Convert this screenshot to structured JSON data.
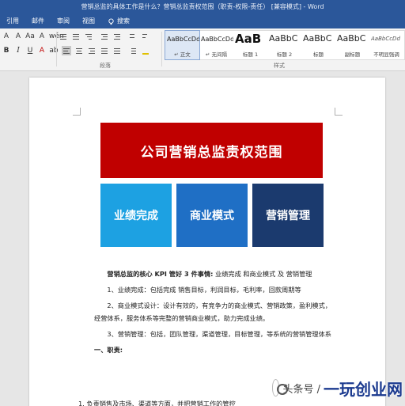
{
  "window": {
    "title": "营销总监的具体工作是什么？营销总监责权范围（职责-权限-责任） [兼容模式] - Word"
  },
  "ribbon_tabs": [
    "引用",
    "邮件",
    "审阅",
    "视图"
  ],
  "search": {
    "label": "搜索",
    "icon": "lightbulb-icon"
  },
  "font_controls": {
    "row1": [
      "A",
      "A",
      "Aa",
      "A",
      "wén",
      "A"
    ],
    "row2": [
      "B",
      "I",
      "U",
      "abc",
      "x₂",
      "x²"
    ],
    "row3": [
      "A",
      "ab",
      "A",
      "A",
      "A",
      "字"
    ]
  },
  "groups": {
    "paragraph_label": "段落",
    "styles_label": "样式"
  },
  "styles": [
    {
      "sample": "AaBbCcDd",
      "name": "↵ 正文",
      "selected": true
    },
    {
      "sample": "AaBbCcDd",
      "name": "↵ 无间隔",
      "selected": false
    },
    {
      "sample": "AaB",
      "name": "标题 1",
      "selected": false
    },
    {
      "sample": "AaBbC",
      "name": "标题 2",
      "selected": false
    },
    {
      "sample": "AaBbC",
      "name": "标题",
      "selected": false
    },
    {
      "sample": "AaBbC",
      "name": "副标题",
      "selected": false
    },
    {
      "sample": "AaBbCcDd",
      "name": "不明显强调",
      "selected": false
    }
  ],
  "document": {
    "banner": "公司营销总监责权范围",
    "cards": [
      "业绩完成",
      "商业模式",
      "营销管理"
    ],
    "kpi_intro_bold": "营销总监的核心 KPI 管好 3 件事情:",
    "kpi_intro_rest": " 业绩完成 和商业模式 及 营销管理",
    "item1": "1、业绩完成：包括完成 销售目标，利润目标，毛利率，回款周期等",
    "item2": "2、商业模式设计：设计有效的，有竞争力的商业模式、营销政策，盈利模式，经营体系，服务体系等完整的营销商业模式，助力完成业绩。",
    "item3": "3、营销管理：包括，团队管理，渠道管理，目标管理，等系统的营销管理体系",
    "section1": "一、职责:",
    "list1": "1. 负责销售及市场、渠道等方面，并把营销工作的管控"
  },
  "watermark": {
    "prefix": "头条号 / ",
    "brand": "一玩创业网"
  },
  "colors": {
    "titlebar": "#2b579a",
    "banner": "#c00000",
    "card1": "#1da1e2",
    "card2": "#1f6fc5",
    "card3": "#1b3a6e"
  }
}
